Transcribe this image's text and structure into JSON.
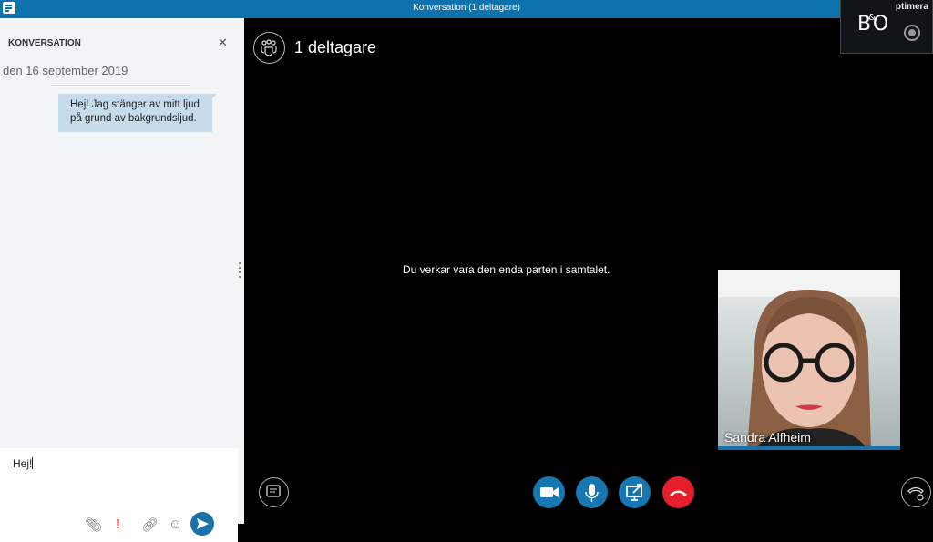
{
  "window": {
    "title": "Konversation (1 deltagare)"
  },
  "chat": {
    "heading": "KONVERSATION",
    "date": "den 16 september 2019",
    "messages": [
      {
        "line1": "Hej! Jag stänger av mitt ljud",
        "line2": "på grund av bakgrundsljud."
      }
    ],
    "input_value": "Hej!"
  },
  "call": {
    "participants": "1 deltagare",
    "status_message": "Du verkar vara den enda parten i samtalet.",
    "self_video_name": "Sandra Alfheim",
    "buttons": [
      "video-icon",
      "microphone-icon",
      "share-screen-icon",
      "hang-up-icon"
    ]
  },
  "overlay": {
    "label": "ptimera",
    "logo": "B&O"
  },
  "colors": {
    "accent": "#1677b3",
    "hangup": "#e41e2b",
    "titlebar": "#0b72ad",
    "urgent": "#e81123"
  }
}
